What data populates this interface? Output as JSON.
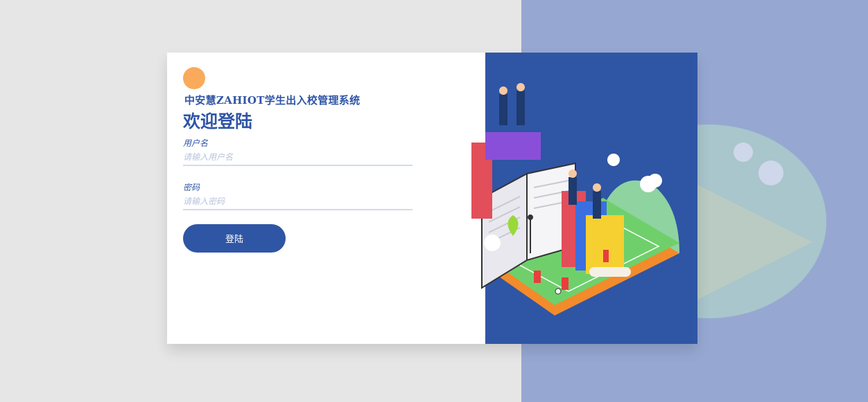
{
  "app": {
    "system_name": "中安慧ZAHIOT学生出入校管理系统",
    "welcome_title": "欢迎登陆"
  },
  "form": {
    "username_label": "用户名",
    "username_placeholder": "请输入用户名",
    "username_value": "",
    "password_label": "密码",
    "password_placeholder": "请输入密码",
    "password_value": "",
    "login_button": "登陆"
  },
  "colors": {
    "brand_blue": "#2f55a5",
    "accent_orange": "#f9aa5b",
    "page_gray": "#e6e6e6",
    "light_blue": "#96a8d2"
  },
  "illustration": "isometric-campus-books-graduates"
}
